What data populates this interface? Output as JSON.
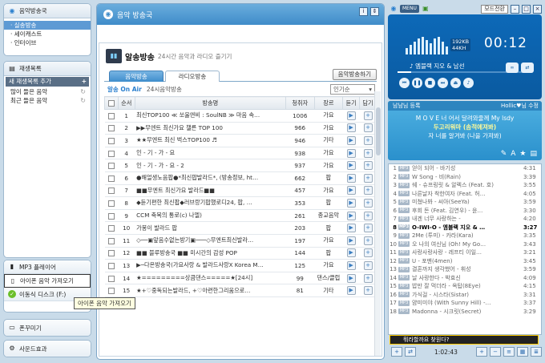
{
  "left": {
    "music_station": {
      "title": "음악방송국",
      "items": [
        "실송방송",
        "세이캐스트",
        "인터이브"
      ]
    },
    "playlist": {
      "title": "재생목록",
      "new_playlist": "새 재생목록 추가",
      "items": [
        "많이 들은 음악",
        "최근 들은 음악"
      ]
    },
    "mp3_player": "MP3 플레이어",
    "iphone_import": "아이폰 음악 가져오기",
    "portable_disk": "이동식 디스크 (F:)",
    "tooltip": "아이폰 음악 가져오기",
    "ringtone": "폰꾸미기",
    "sound_effect": "사운드효과"
  },
  "center": {
    "header_title": "음악 방송국",
    "page_title": "알송방송",
    "page_subtitle": "24시간 음악과 라디오 즐기기",
    "tabs": [
      "음악방송",
      "라디오방송"
    ],
    "button_listen": "음악방송하기",
    "on_air": "알송 On Air",
    "on_air_sub": "24시음악방송",
    "sort": "인기순",
    "columns": [
      "순서",
      "방송명",
      "청취자",
      "장르",
      "듣기",
      "담기"
    ],
    "rows": [
      {
        "no": "1",
        "name": "최신TOP100 ≪ 쏘울앤비 : SoulNB ≫ 마음 속…",
        "listeners": "1006",
        "genre": "가요"
      },
      {
        "no": "2",
        "name": "▶▶무엔트 최신가요 챌른 TOP 100",
        "listeners": "966",
        "genre": "가요"
      },
      {
        "no": "3",
        "name": "★★무엔트 최신 벅스TOP100 ♬",
        "listeners": "946",
        "genre": "기타"
      },
      {
        "no": "4",
        "name": "인 - 기 - 가 - 요",
        "listeners": "938",
        "genre": "가요"
      },
      {
        "no": "5",
        "name": "인 - 기 - 가 - 요 - 2",
        "listeners": "937",
        "genre": "가요"
      },
      {
        "no": "6",
        "name": "●해얼생노음팝●*최신팝발라드*, (방송정보, ht…",
        "listeners": "662",
        "genre": "팝"
      },
      {
        "no": "7",
        "name": "■■무엔트 최신가요 발라드■■",
        "listeners": "457",
        "genre": "가요"
      },
      {
        "no": "8",
        "name": "◆듣기편한 최신팝◆러브랑기팝했로디24, 팝, …",
        "listeners": "353",
        "genre": "팝"
      },
      {
        "no": "9",
        "name": "CCM 축복의 통로(c) 나엘)",
        "listeners": "261",
        "genre": "종교음악"
      },
      {
        "no": "10",
        "name": "가봉이 발라드 팝",
        "listeners": "203",
        "genre": "팝"
      },
      {
        "no": "11",
        "name": "◇──▣앞음수없는방기▣───◇무엔트최신발라…",
        "listeners": "197",
        "genre": "가요"
      },
      {
        "no": "12",
        "name": "■■ 블루방송국 ■■ 미시간의 감성 POP",
        "listeners": "144",
        "genre": "팝"
      },
      {
        "no": "13",
        "name": "▶─다온방송국(가요사랑 & 발라드사랑X Korea M…",
        "listeners": "125",
        "genre": "가요"
      },
      {
        "no": "14",
        "name": "★=========상큼댄스=====★[24시]",
        "listeners": "99",
        "genre": "댄스/클럽"
      },
      {
        "no": "15",
        "name": "★+♡중독되는발라드, +♡아련한그리움으로…",
        "listeners": "81",
        "genre": "기타"
      }
    ]
  },
  "right": {
    "menu": "MENU",
    "mode": "모드전환",
    "kbps": "192KB",
    "khz": "44KH",
    "time": "00:12",
    "now_playing": "엠블랙 지오 & 남선",
    "lyric_bar_left": "남남님 등록",
    "lyric_bar_right": "Hollic♥님 수정",
    "lyrics": [
      "M O V E 너 어서 달려와줄께 My lsdy",
      "두고리워마 (솜적에져봐)",
      "자 너를 알겨봐 (나을 가져봐)"
    ],
    "playlist": [
      {
        "n": "1",
        "title": "얻이 되어 - 바기성",
        "dur": "4:31"
      },
      {
        "n": "2",
        "title": "W Song - 비(Rain)",
        "dur": "3:39"
      },
      {
        "n": "3",
        "title": "쉐 - 슈프링릿 & 알렉스 (Feat. 호)",
        "dur": "3:55"
      },
      {
        "n": "4",
        "title": "나른날자 착한여자 (Feat. 허…",
        "dur": "4:05"
      },
      {
        "n": "5",
        "title": "미쳤나봐 - 씨아(SeeYa)",
        "dur": "3:59"
      },
      {
        "n": "6",
        "title": "후회 돈 (Feat. 김연우) - 윤…",
        "dur": "3:30"
      },
      {
        "n": "7",
        "title": "내겐 너무 사랑하는 -",
        "dur": "4:20"
      },
      {
        "n": "8",
        "title": "O-IWI-O - 엠블랙 지오 & …",
        "dur": "3:27"
      },
      {
        "n": "9",
        "title": "2Me (투미) - 카라(Kara)",
        "dur": "3:35"
      },
      {
        "n": "10",
        "title": "오 나의 여신님 (Oh! My Go…",
        "dur": "3:43"
      },
      {
        "n": "11",
        "title": "사랑사랑사랑 - 레프티 이일…",
        "dur": "3:21"
      },
      {
        "n": "12",
        "title": "U - 포맨(4men)",
        "dur": "3:45"
      },
      {
        "n": "13",
        "title": "결혼까지 생각했어 - 휘성",
        "dur": "3:59"
      },
      {
        "n": "14",
        "title": "날 사랑한다 - 박효신",
        "dur": "4:09"
      },
      {
        "n": "15",
        "title": "밥만 잘 먹더라 - 옥탑(8Eye)",
        "dur": "4:15"
      },
      {
        "n": "16",
        "title": "가식걸 - 시스타(Sistar)",
        "dur": "3:31"
      },
      {
        "n": "17",
        "title": "얌미미야 (With Sunny Hill) -…",
        "dur": "3:37"
      },
      {
        "n": "18",
        "title": "Madonna - 시크릿(Secret)",
        "dur": "3:29"
      }
    ],
    "search_placeholder": "뭐라할까요 찾원다?",
    "total_time": "1:02:43"
  }
}
